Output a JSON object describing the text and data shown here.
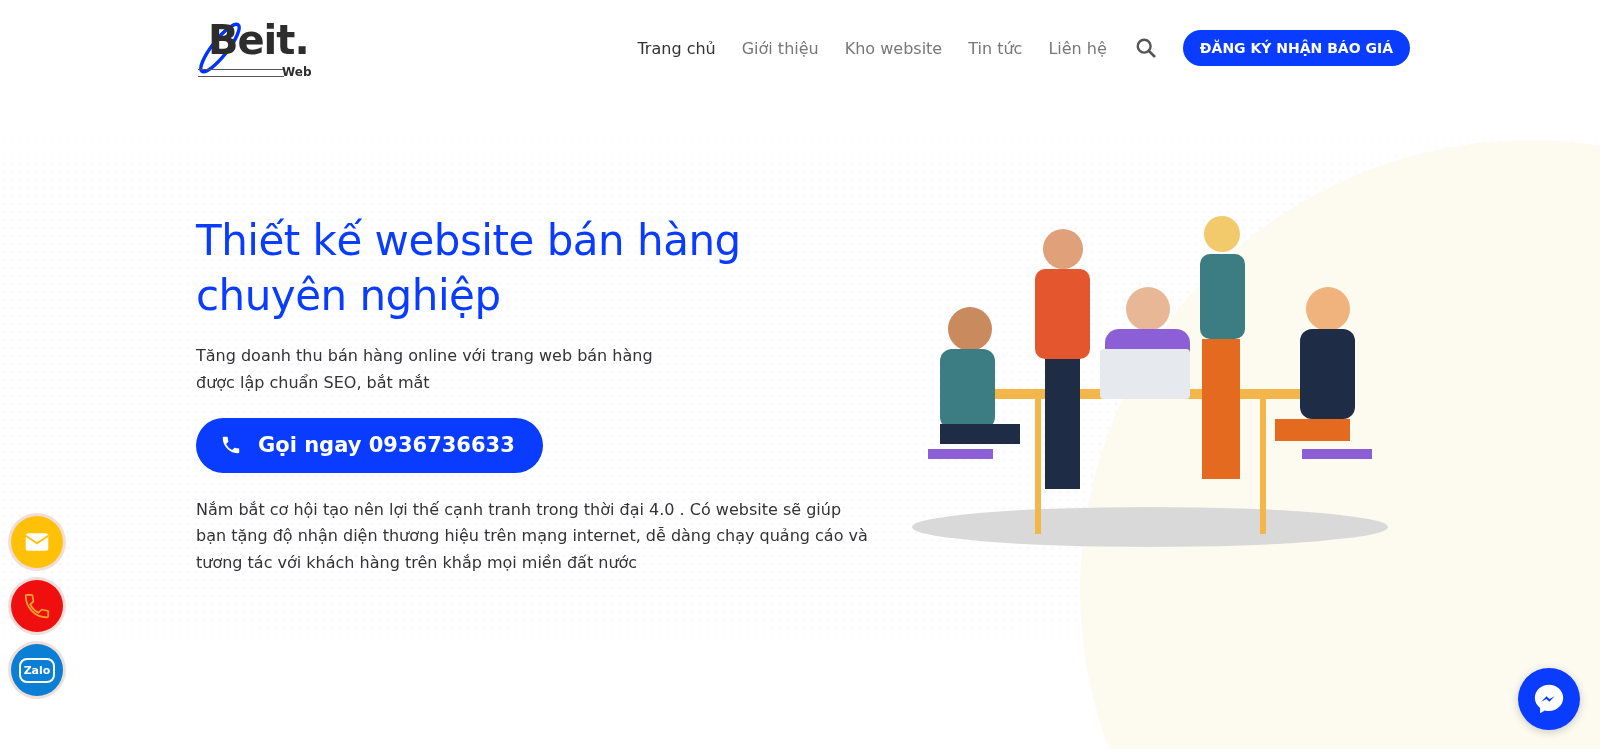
{
  "logo": {
    "main": "Beit.",
    "sub": "Web"
  },
  "nav": [
    {
      "label": "Trang chủ",
      "selected": true
    },
    {
      "label": "Giới thiệu",
      "selected": false
    },
    {
      "label": "Kho website",
      "selected": false
    },
    {
      "label": "Tin tức",
      "selected": false
    },
    {
      "label": "Liên hệ",
      "selected": false
    }
  ],
  "cta_button": "ĐĂNG KÝ NHẬN BÁO GIÁ",
  "hero": {
    "title": "Thiết kế website bán hàng chuyên nghiệp",
    "subtitle": "Tăng doanh thu bán hàng online với trang web bán hàng được lập chuẩn SEO, bắt mắt",
    "call_button": "Gọi ngay 0936736633",
    "description": "Nắm bắt cơ hội tạo nên lợi thế cạnh tranh trong thời đại 4.0 . Có website sẽ giúp bạn tặng độ nhận diện thương hiệu trên mạng internet, dễ dàng chạy quảng cáo và tương tác với khách hàng trên khắp mọi miền đất nước"
  },
  "floating_contacts": [
    {
      "kind": "email",
      "color": "#ffc107"
    },
    {
      "kind": "phone",
      "color": "#f00f0f"
    },
    {
      "kind": "zalo",
      "color": "#0a7fd3",
      "label": "Zalo"
    }
  ]
}
